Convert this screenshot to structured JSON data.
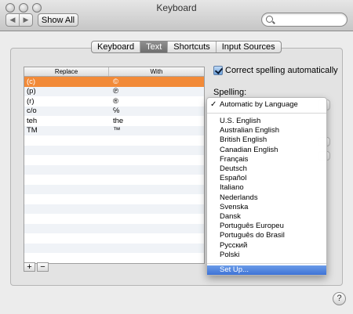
{
  "window": {
    "title": "Keyboard"
  },
  "toolbar": {
    "back_icon": "◀",
    "forward_icon": "▶",
    "show_all_label": "Show All",
    "search_value": "",
    "search_placeholder": ""
  },
  "tabs": [
    {
      "label": "Keyboard",
      "active": false
    },
    {
      "label": "Text",
      "active": true
    },
    {
      "label": "Shortcuts",
      "active": false
    },
    {
      "label": "Input Sources",
      "active": false
    }
  ],
  "table": {
    "columns": [
      "Replace",
      "With"
    ],
    "rows": [
      {
        "replace": "(c)",
        "with": "©",
        "selected": true
      },
      {
        "replace": "(p)",
        "with": "℗",
        "selected": false
      },
      {
        "replace": "(r)",
        "with": "®",
        "selected": false
      },
      {
        "replace": "c/o",
        "with": "℅",
        "selected": false
      },
      {
        "replace": "teh",
        "with": "the",
        "selected": false
      },
      {
        "replace": "TM",
        "with": "™",
        "selected": false
      }
    ],
    "add_label": "+",
    "remove_label": "−"
  },
  "options": {
    "correct_spelling_label": "Correct spelling automatically",
    "correct_spelling_checked": true,
    "spelling_label": "Spelling:"
  },
  "spelling_menu": {
    "selected": "Automatic by Language",
    "languages": [
      "U.S. English",
      "Australian English",
      "British English",
      "Canadian English",
      "Français",
      "Deutsch",
      "Español",
      "Italiano",
      "Nederlands",
      "Svenska",
      "Dansk",
      "Português Europeu",
      "Português do Brasil",
      "Русский",
      "Polski"
    ],
    "setup_label": "Set Up..."
  },
  "help_label": "?"
}
